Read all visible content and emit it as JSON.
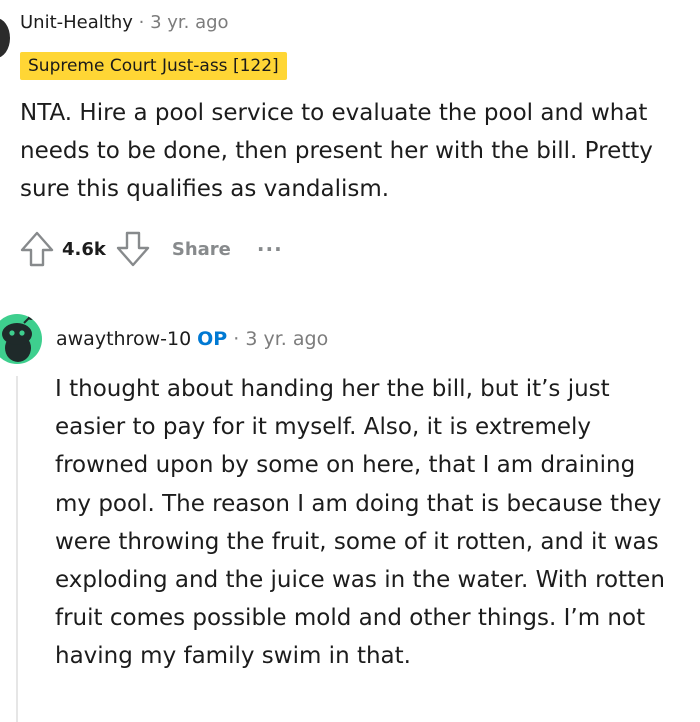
{
  "comment1": {
    "username": "Unit-Healthy",
    "separator": " · ",
    "timestamp": "3 yr. ago",
    "flair": "Supreme Court Just-ass [122]",
    "body": "NTA. Hire a pool service to evaluate the pool and what needs to be done, then present her with the bill. Pretty sure this qualifies as vandalism.",
    "votes": "4.6k",
    "share_label": "Share",
    "more_label": "···"
  },
  "comment2": {
    "username": "awaythrow-10",
    "op_badge": "OP",
    "separator": " · ",
    "timestamp": "3 yr. ago",
    "body": "I thought about handing her the bill, but it’s just easier to pay for it myself. Also, it is extremely frowned upon by some on here, that I am draining my pool. The reason I am doing that is because they were throwing the fruit, some of it rotten, and it was exploding and the juice was in the water. With rotten fruit comes possible mold and other things. I’m not having my family swim in that."
  },
  "colors": {
    "flair_bg": "#ffd635",
    "op_blue": "#0079d3",
    "avatar_green": "#3ecf8e",
    "muted": "#878a8c"
  },
  "icons": {
    "upvote": "upvote-arrow-icon",
    "downvote": "downvote-arrow-icon",
    "more": "more-options-icon",
    "avatar": "snoo-avatar-icon"
  }
}
